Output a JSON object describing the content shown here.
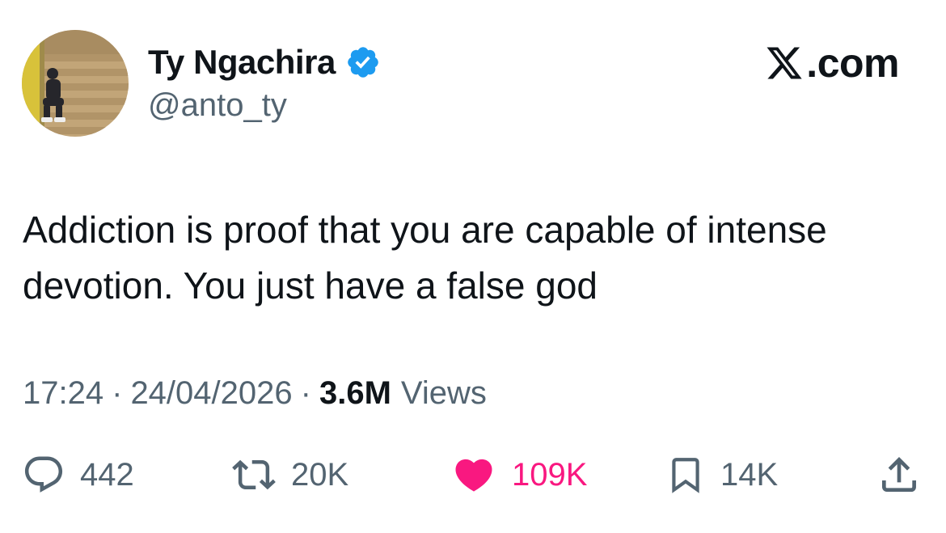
{
  "author": {
    "display_name": "Ty Ngachira",
    "handle": "@anto_ty",
    "verified": true
  },
  "brand": {
    "text": ".com",
    "icon": "x-logo-icon"
  },
  "tweet": {
    "text": "Addiction is proof that you are capable of intense devotion. You just have a false god"
  },
  "meta": {
    "time": "17:24",
    "separator": "·",
    "date": "24/04/2026",
    "views_count": "3.6M",
    "views_label": "Views"
  },
  "actions": {
    "reply_count": "442",
    "repost_count": "20K",
    "like_count": "109K",
    "bookmark_count": "14K"
  },
  "colors": {
    "text": "#0f1419",
    "secondary": "#536471",
    "verified": "#1d9bf0",
    "like": "#f91880"
  }
}
